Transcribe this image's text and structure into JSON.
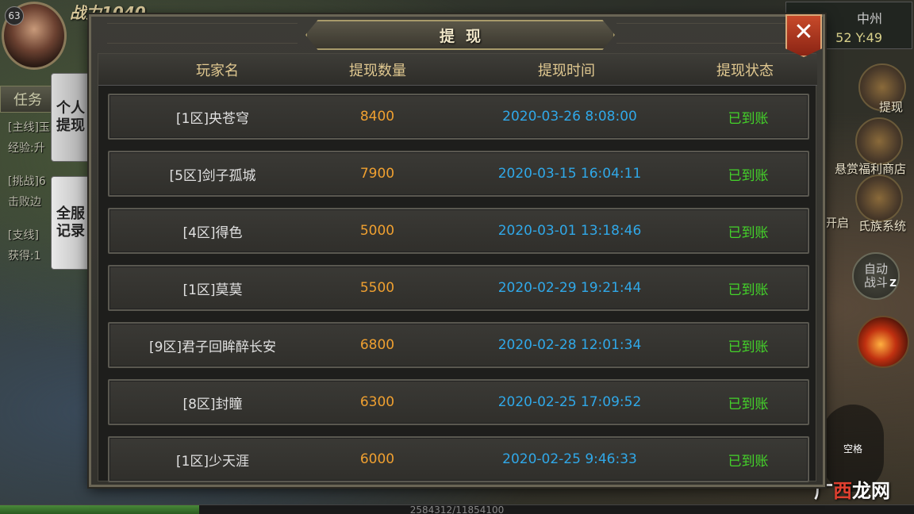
{
  "hud": {
    "level": "63",
    "power": "战力1040",
    "task_tab": "任务",
    "log_lines": [
      "[主线]玉",
      "经验:升",
      "[挑战]6",
      "击败边",
      "[支线]",
      "获得:1"
    ],
    "map_name": "中州",
    "map_coords": "52 Y:49",
    "side_labels": {
      "withdraw": "提现",
      "bounty_shop": "悬赏福利商店",
      "clan_system": "氏族系统",
      "open_hint": "开启"
    },
    "auto_battle": [
      "自动",
      "战斗"
    ],
    "auto_key": "Z",
    "space_label": "空格",
    "exp_text": "2584312/11854100",
    "exp_fraction": 0.218
  },
  "watermark": {
    "prefix": "广",
    "accent": "西",
    "suffix": "龙网"
  },
  "side_tabs": {
    "personal": [
      "个人",
      "提现"
    ],
    "all": [
      "全服",
      "记录"
    ]
  },
  "panel": {
    "title": "提现",
    "close_symbol": "✕",
    "columns": [
      "玩家名",
      "提现数量",
      "提现时间",
      "提现状态"
    ],
    "rows": [
      {
        "name": "[1区]央苍穹",
        "amount": "8400",
        "time": "2020-03-26 8:08:00",
        "status": "已到账"
      },
      {
        "name": "[5区]剑子孤城",
        "amount": "7900",
        "time": "2020-03-15 16:04:11",
        "status": "已到账"
      },
      {
        "name": "[4区]得色",
        "amount": "5000",
        "time": "2020-03-01 13:18:46",
        "status": "已到账"
      },
      {
        "name": "[1区]莫莫",
        "amount": "5500",
        "time": "2020-02-29 19:21:44",
        "status": "已到账"
      },
      {
        "name": "[9区]君子回眸醉长安",
        "amount": "6800",
        "time": "2020-02-28 12:01:34",
        "status": "已到账"
      },
      {
        "name": "[8区]封瞳",
        "amount": "6300",
        "time": "2020-02-25 17:09:52",
        "status": "已到账"
      },
      {
        "name": "[1区]少天涯",
        "amount": "6000",
        "time": "2020-02-25 9:46:33",
        "status": "已到账"
      }
    ]
  }
}
